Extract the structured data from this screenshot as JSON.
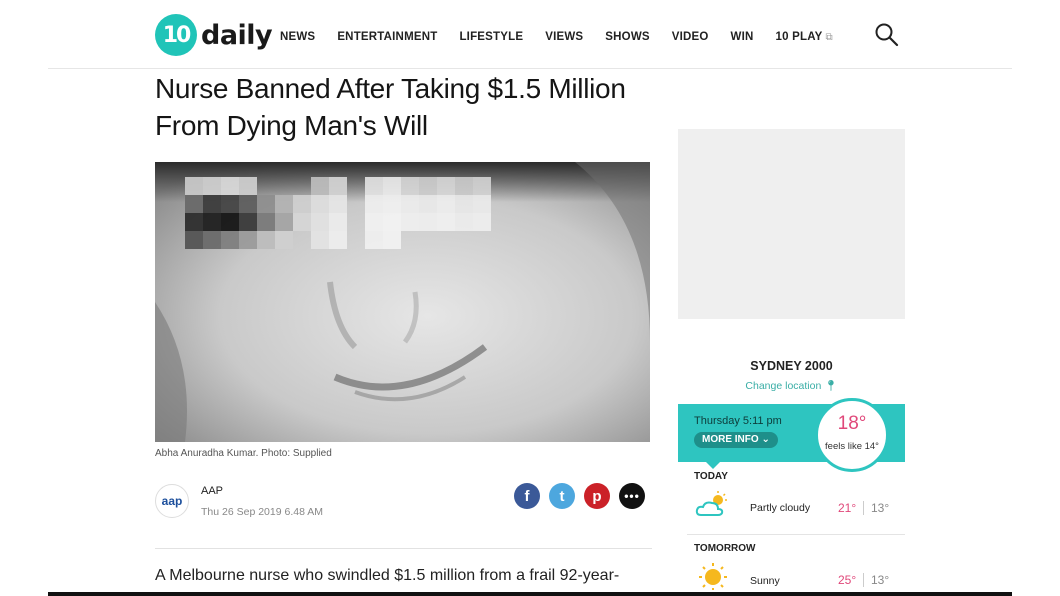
{
  "brand": {
    "logo_mark": "10",
    "logo_text": "daily",
    "accent": "#20c4b8"
  },
  "nav": {
    "items": [
      "NEWS",
      "ENTERTAINMENT",
      "LIFESTYLE",
      "VIEWS",
      "SHOWS",
      "VIDEO",
      "WIN",
      "10 PLAY"
    ],
    "external_icon": "external-link-icon"
  },
  "article": {
    "headline_line1": "Nurse Banned After Taking $1.5 Million",
    "headline_line2": "From Dying Man's Will",
    "caption": "Abha Anuradha Kumar. Photo: Supplied",
    "author": "AAP",
    "author_logo": "aap",
    "date": "Thu 26 Sep 2019 6.48 AM",
    "body_first_line": "A Melbourne nurse who swindled $1.5 million from a frail 92-year-"
  },
  "share": {
    "facebook": "f",
    "twitter": "t",
    "pinterest": "p",
    "more": "•••"
  },
  "weather": {
    "city": "SYDNEY 2000",
    "change_location": "Change location",
    "day_time": "Thursday 5:11 pm",
    "more_info": "MORE INFO",
    "current_temp": "18°",
    "feels_like": "feels like 14°",
    "accent": "#2ec5c0",
    "forecast": [
      {
        "label": "TODAY",
        "icon": "partly-cloudy-icon",
        "desc": "Partly cloudy",
        "max": "21°",
        "min": "13°"
      },
      {
        "label": "TOMORROW",
        "icon": "sunny-icon",
        "desc": "Sunny",
        "max": "25°",
        "min": "13°"
      }
    ]
  }
}
